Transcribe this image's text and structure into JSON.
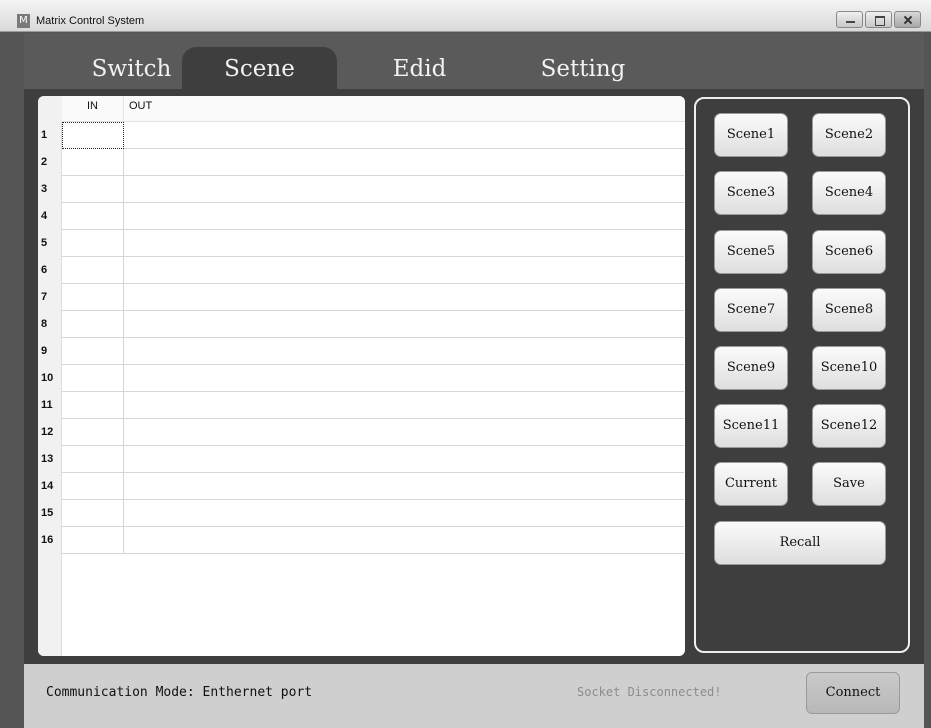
{
  "window": {
    "title": "Matrix Control System",
    "app_icon_letter": "M"
  },
  "tabs": [
    {
      "label": "Switch",
      "active": false
    },
    {
      "label": "Scene",
      "active": true
    },
    {
      "label": "Edid",
      "active": false
    },
    {
      "label": "Setting",
      "active": false
    }
  ],
  "table": {
    "headers": {
      "in": "IN",
      "out": "OUT"
    },
    "rows": [
      {
        "num": "1",
        "in": "",
        "out": ""
      },
      {
        "num": "2",
        "in": "",
        "out": ""
      },
      {
        "num": "3",
        "in": "",
        "out": ""
      },
      {
        "num": "4",
        "in": "",
        "out": ""
      },
      {
        "num": "5",
        "in": "",
        "out": ""
      },
      {
        "num": "6",
        "in": "",
        "out": ""
      },
      {
        "num": "7",
        "in": "",
        "out": ""
      },
      {
        "num": "8",
        "in": "",
        "out": ""
      },
      {
        "num": "9",
        "in": "",
        "out": ""
      },
      {
        "num": "10",
        "in": "",
        "out": ""
      },
      {
        "num": "11",
        "in": "",
        "out": ""
      },
      {
        "num": "12",
        "in": "",
        "out": ""
      },
      {
        "num": "13",
        "in": "",
        "out": ""
      },
      {
        "num": "14",
        "in": "",
        "out": ""
      },
      {
        "num": "15",
        "in": "",
        "out": ""
      },
      {
        "num": "16",
        "in": "",
        "out": ""
      }
    ]
  },
  "scene_buttons": {
    "scene1": "Scene1",
    "scene2": "Scene2",
    "scene3": "Scene3",
    "scene4": "Scene4",
    "scene5": "Scene5",
    "scene6": "Scene6",
    "scene7": "Scene7",
    "scene8": "Scene8",
    "scene9": "Scene9",
    "scene10": "Scene10",
    "scene11": "Scene11",
    "scene12": "Scene12",
    "current": "Current",
    "save": "Save",
    "recall": "Recall"
  },
  "status": {
    "mode": "Communication Mode: Enthernet port",
    "socket": "Socket Disconnected!",
    "connect_label": "Connect"
  },
  "colors": {
    "background": "#555555",
    "panel": "#3e3e3e",
    "status_bar": "#cfcfcf",
    "socket_text": "#8c8c8c"
  }
}
